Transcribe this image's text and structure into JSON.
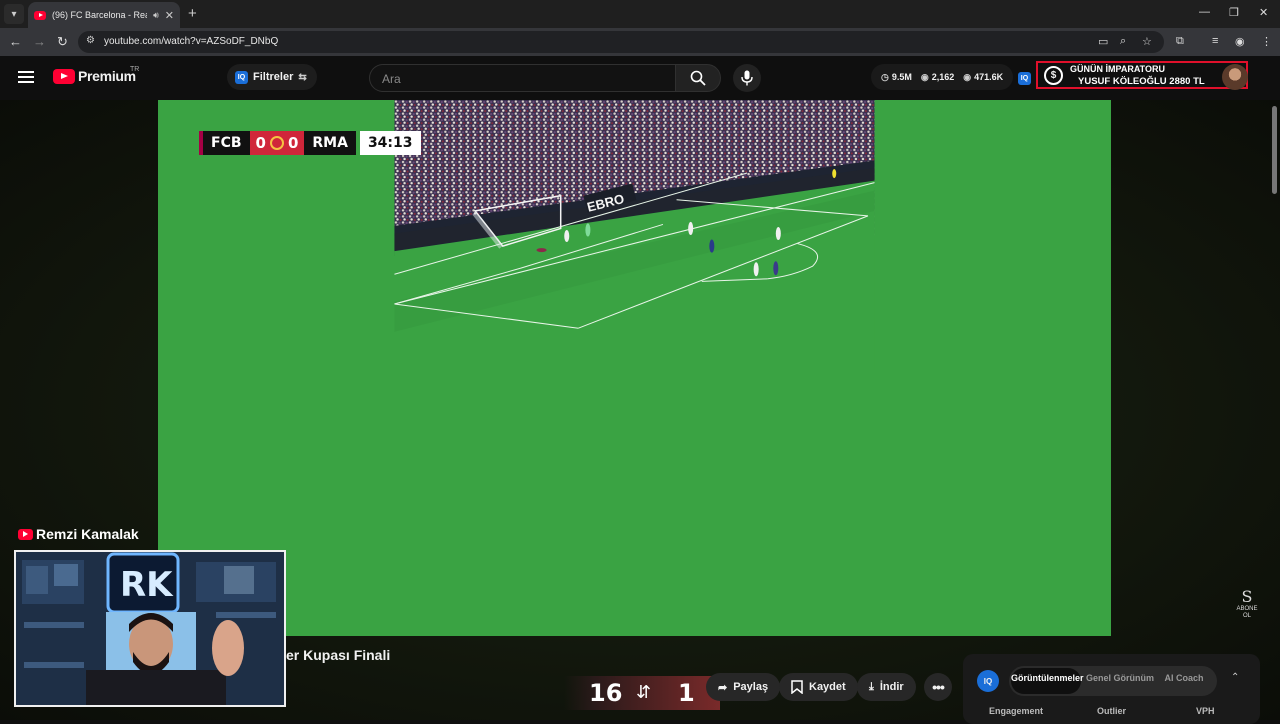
{
  "browser": {
    "tab_title": "(96) FC Barcelona - Real Ma",
    "url": "youtube.com/watch?v=AZSoDF_DNbQ"
  },
  "header": {
    "logo_text": "Premium",
    "logo_region": "TR",
    "filters_label": "Filtreler",
    "search_placeholder": "Ara",
    "stats": {
      "views": "9.5M",
      "comments": "2,162",
      "likes": "471.6K"
    }
  },
  "donation": {
    "title": "GÜNÜN İMPARATORU",
    "text": "YUSUF KÖLEOĞLU 2880 TL"
  },
  "video": {
    "scoreboard": {
      "home": "FCB",
      "home_score": "0",
      "away_score": "0",
      "away": "RMA",
      "time": "34:13"
    },
    "ad_board": "EBRO",
    "abone": [
      "ABONE",
      "OL"
    ]
  },
  "streamer": {
    "name": "Remzi Kamalak"
  },
  "below_video": {
    "title_visible": "er Kupası Finali",
    "score_left": "16",
    "score_right": "1",
    "actions": {
      "share": "Paylaş",
      "save": "Kaydet",
      "download": "İndir"
    }
  },
  "analytics": {
    "logo": "IQ",
    "tabs": [
      "Görüntülenmeler",
      "Genel Görünüm",
      "AI Coach"
    ],
    "active_tab": "Görüntülenmeler",
    "columns": [
      "Engagement",
      "Outlier",
      "VPH"
    ]
  },
  "colors": {
    "yt_red": "#ff0033",
    "donation_border": "#e0102b",
    "pitch_green": "#3aa343"
  }
}
